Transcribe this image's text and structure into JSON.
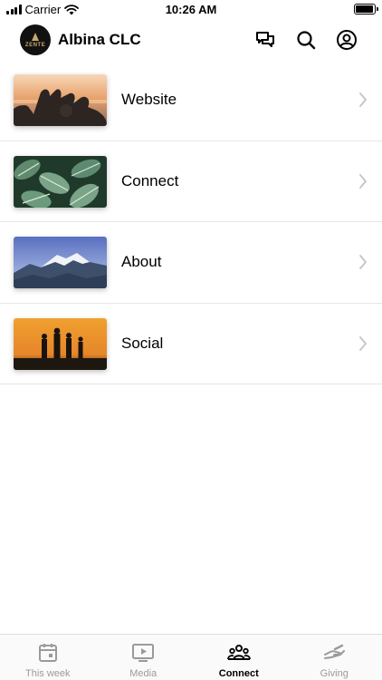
{
  "status_bar": {
    "carrier": "Carrier",
    "time": "10:26 AM",
    "battery_level": 0.95
  },
  "header": {
    "title": "Albina CLC",
    "logo_text": "ZENTE",
    "icons": [
      "chat-icon",
      "search-icon",
      "profile-icon"
    ]
  },
  "menu": {
    "items": [
      {
        "label": "Website",
        "image": "friends-heart-hands-sunset"
      },
      {
        "label": "Connect",
        "image": "green-leaves"
      },
      {
        "label": "About",
        "image": "snowy-mountains"
      },
      {
        "label": "Social",
        "image": "family-silhouette-sunset"
      }
    ]
  },
  "tab_bar": {
    "active_tab": "Connect",
    "tabs": [
      {
        "label": "This week",
        "icon": "calendar-icon"
      },
      {
        "label": "Media",
        "icon": "play-icon"
      },
      {
        "label": "Connect",
        "icon": "people-icon"
      },
      {
        "label": "Giving",
        "icon": "giving-hand-icon"
      }
    ]
  },
  "colors": {
    "active": "#000000",
    "inactive": "#9a9a9a",
    "divider": "#e6e6e6",
    "chevron": "#c4c4c4"
  }
}
